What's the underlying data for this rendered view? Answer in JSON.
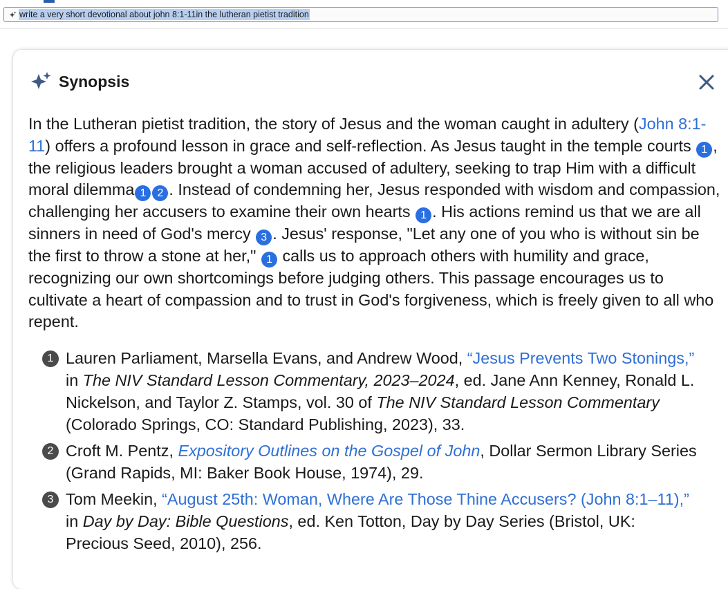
{
  "search": {
    "query": "write a very short devotional about john 8:1-11in the lutheran pietist tradition"
  },
  "panel": {
    "title": "Synopsis",
    "close_icon": "close-icon"
  },
  "synopsis": {
    "p1": "In the Lutheran pietist tradition, the story of Jesus and the woman caught in adultery (",
    "link_john": "John 8:1-11",
    "p2": ") offers a profound lesson in grace and self-reflection. As Jesus taught in the temple courts",
    "c1": "1",
    "p3": ", the religious leaders brought a woman accused of adultery, seeking to trap Him with a difficult moral dilemma",
    "c2": "1",
    "c3": "2",
    "p4": ". Instead of condemning her, Jesus responded with wisdom and compassion, challenging her accusers to examine their own hearts",
    "c4": "1",
    "p5": ". His actions remind us that we are all sinners in need of God's mercy",
    "c5": "3",
    "p6": ". Jesus' response, \"Let any one of you who is without sin be the first to throw a stone at her,\"",
    "c6": "1",
    "p7": " calls us to approach others with humility and grace, recognizing our own shortcomings before judging others. This passage encourages us to cultivate a heart of compassion and to trust in God's forgiveness, which is freely given to all who repent."
  },
  "references": [
    {
      "num": "1",
      "a": "Lauren Parliament, Marsella Evans, and Andrew Wood, ",
      "link": "“Jesus Prevents Two Stonings,”",
      "b": " in ",
      "it1": "The NIV Standard Lesson Commentary, 2023–2024",
      "c": ", ed. Jane Ann Kenney, Ronald L. Nickelson, and Taylor Z. Stamps, vol. 30 of ",
      "it2": "The NIV Standard Lesson Commentary",
      "d": " (Colorado Springs, CO: Standard Publishing, 2023), 33."
    },
    {
      "num": "2",
      "a": "Croft M. Pentz, ",
      "link": "Expository Outlines on the Gospel of John",
      "b": ", Dollar Sermon Library Series (Grand Rapids, MI: Baker Book House, 1974), 29."
    },
    {
      "num": "3",
      "a": "Tom Meekin, ",
      "link": "“August 25th: Woman, Where Are Those Thine Accusers? (John 8:1–11),”",
      "b": " in ",
      "it1": "Day by Day: Bible Questions",
      "c": ", ed. Ken Totton, Day by Day Series (Bristol, UK: Precious Seed, 2010), 256."
    }
  ],
  "colors": {
    "link": "#2f6fd6",
    "citation_badge": "#2a6fe0",
    "reference_badge": "#4a4a4a",
    "search_highlight": "#b7cff1"
  }
}
